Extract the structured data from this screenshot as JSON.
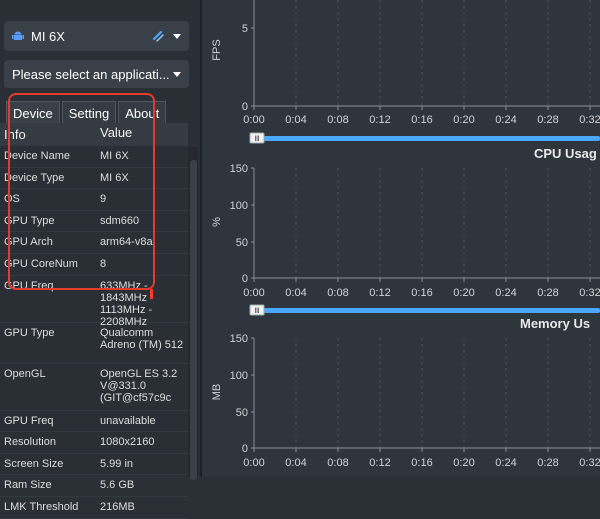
{
  "device_selector": {
    "value": "MI 6X"
  },
  "app_selector": {
    "placeholder": "Please select an applicati..."
  },
  "tabs": [
    "Device",
    "Setting",
    "About"
  ],
  "info_table": {
    "headers": {
      "key": "Info",
      "value": "Value"
    },
    "rows": [
      {
        "key": "Device Name",
        "value": "MI 6X"
      },
      {
        "key": "Device Type",
        "value": "MI 6X"
      },
      {
        "key": "OS",
        "value": "9"
      },
      {
        "key": "GPU Type",
        "value": "sdm660"
      },
      {
        "key": "GPU Arch",
        "value": "arm64-v8a"
      },
      {
        "key": "GPU CoreNum",
        "value": "8"
      },
      {
        "key": "GPU Freq",
        "value_lines": [
          "633MHz -",
          "1843MHz",
          "1113MHz -",
          "2208MHz"
        ]
      },
      {
        "key": "GPU Type",
        "value_lines": [
          "Qualcomm",
          "Adreno (TM) 512"
        ]
      },
      {
        "key": "OpenGL",
        "value_lines": [
          "OpenGL ES 3.2",
          "V@331.0",
          "(GIT@cf57c9c"
        ]
      },
      {
        "key": "GPU Freq",
        "value": "unavailable"
      },
      {
        "key": "Resolution",
        "value": "1080x2160"
      },
      {
        "key": "Screen Size",
        "value": "5.99 in"
      },
      {
        "key": "Ram Size",
        "value": "5.6 GB"
      },
      {
        "key": "LMK Threshold",
        "value": "216MB"
      }
    ]
  },
  "charts": [
    {
      "title": "",
      "ylabel": "FPS",
      "yticks": [
        "5",
        "0"
      ]
    },
    {
      "title": "CPU Usag",
      "ylabel": "%",
      "yticks": [
        "150",
        "100",
        "50",
        "0"
      ]
    },
    {
      "title": "Memory Us",
      "ylabel": "MB",
      "yticks": [
        "150",
        "100",
        "50",
        "0"
      ]
    }
  ],
  "timeline": {
    "ticks": [
      "0:00",
      "0:04",
      "0:08",
      "0:12",
      "0:16",
      "0:20",
      "0:24",
      "0:28",
      "0:32"
    ],
    "handle_label": "lll"
  },
  "colors": {
    "bg": "#2b3037",
    "panel": "#3a4048",
    "accent": "#4aa8ff",
    "annotation": "#e33b2e"
  }
}
